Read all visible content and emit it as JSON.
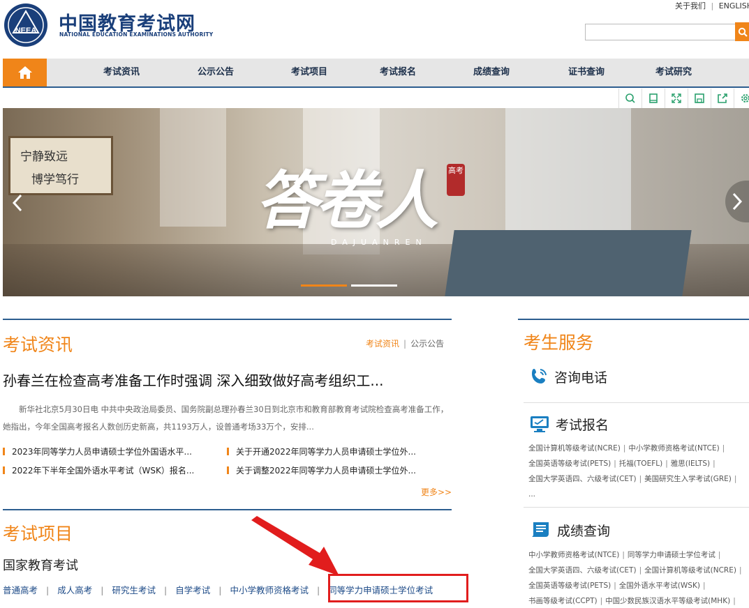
{
  "header": {
    "site_title": "中国教育考试网",
    "site_subtitle": "NATIONAL EDUCATION EXAMINATIONS AUTHORITY",
    "logo_text": "NEEA",
    "top_links": [
      "关于我们",
      "ENGLISH"
    ],
    "search_placeholder": ""
  },
  "nav": {
    "items": [
      "考试资讯",
      "公示公告",
      "考试项目",
      "考试报名",
      "成绩查询",
      "证书查询",
      "考试研究"
    ]
  },
  "banner": {
    "title": "答卷人",
    "seal": "高考",
    "subtitle": "DAJUANREN",
    "scroll_text": [
      "宁静致远",
      "博学笃行"
    ],
    "slides": 2,
    "active_slide": 1
  },
  "news": {
    "section_title": "考试资讯",
    "tabs": [
      "考试资讯",
      "公示公告"
    ],
    "headline": "孙春兰在检查高考准备工作时强调 深入细致做好高考组织工...",
    "summary": "新华社北京5月30日电 中共中央政治局委员、国务院副总理孙春兰30日到北京市和教育部教育考试院检查高考准备工作，她指出，今年全国高考报名人数创历史新高，共1193万人，设普通考场33万个，安排...",
    "items": [
      "2023年同等学力人员申请硕士学位外国语水平...",
      "关于开通2022年同等学力人员申请硕士学位外...",
      "2022年下半年全国外语水平考试（WSK）报名...",
      "关于调整2022年同等学力人员申请硕士学位外..."
    ],
    "more": "更多>>"
  },
  "exams": {
    "section_title": "考试项目",
    "subtitle": "国家教育考试",
    "links": [
      "普通高考",
      "成人高考",
      "研究生考试",
      "自学考试",
      "中小学教师资格考试",
      "同等学力申请硕士学位考试"
    ]
  },
  "services": {
    "section_title": "考生服务",
    "hotline": "咨询电话",
    "registration": {
      "title": "考试报名",
      "links": [
        "全国计算机等级考试(NCRE)",
        "中小学教师资格考试(NTCE)",
        "全国英语等级考试(PETS)",
        "托福(TOEFL)",
        "雅思(IELTS)",
        "全国大学英语四、六级考试(CET)",
        "美国研究生入学考试(GRE)"
      ],
      "ellipsis": "..."
    },
    "scores": {
      "title": "成绩查询",
      "links": [
        "中小学教师资格考试(NTCE)",
        "同等学力申请硕士学位考试",
        "全国大学英语四、六级考试(CET)",
        "全国计算机等级考试(NCRE)",
        "全国英语等级考试(PETS)",
        "全国外语水平考试(WSK)",
        "书画等级考试(CCPT)",
        "中国少数民族汉语水平等级考试(MHK)"
      ]
    }
  },
  "colors": {
    "accent": "#f08519",
    "navy": "#1a3f7a",
    "highlight": "#e11d1d"
  }
}
